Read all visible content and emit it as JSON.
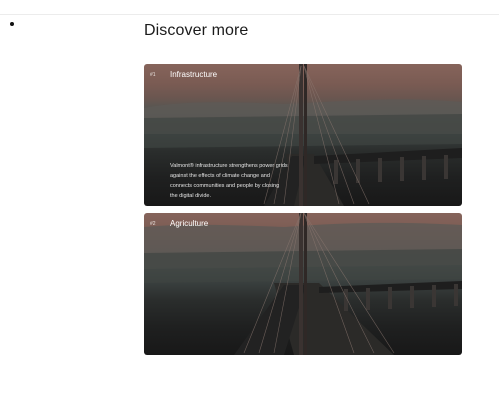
{
  "page": {
    "heading": "Discover more"
  },
  "cards": [
    {
      "number": "#1",
      "title": "Infrastructure",
      "description": "Valmont® infrastructure strengthens power grids against the effects of climate change and connects communities and people by closing the digital divide."
    },
    {
      "number": "#2",
      "title": "Agriculture"
    }
  ],
  "colors": {
    "card_sky_top": "#86645b",
    "card_water": "#1f2020",
    "heading_text": "#1b1b1b",
    "card_text": "#ffffff"
  }
}
